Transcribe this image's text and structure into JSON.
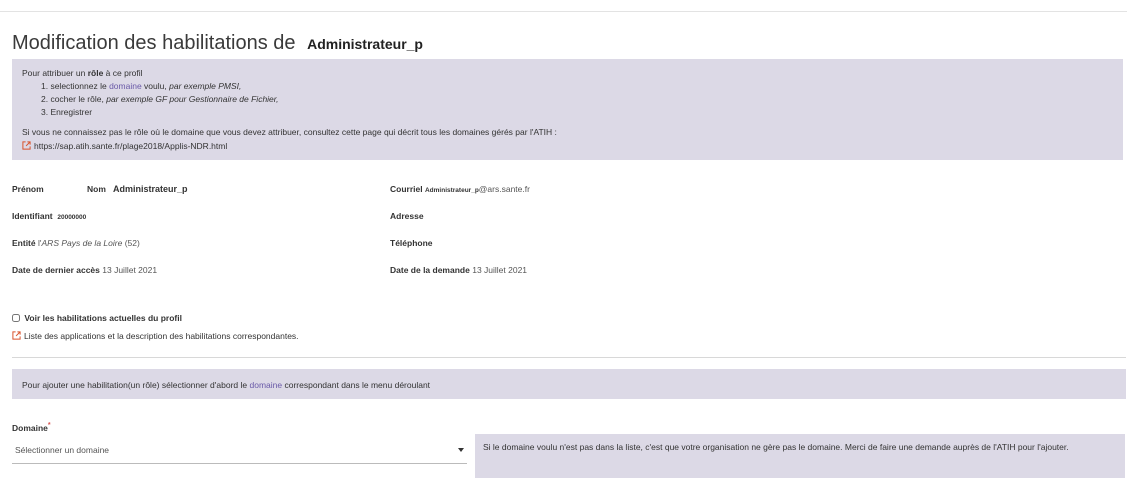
{
  "header": {
    "title": "Modification des habilitations de",
    "target_name": "Administrateur_p"
  },
  "help": {
    "intro_prefix": "Pour attribuer un",
    "intro_bold": "rôle",
    "intro_suffix": "à ce profil",
    "step1_prefix": "1. selectionnez le",
    "step1_domain": "domaine",
    "step1_mid": "voulu,",
    "step1_example": "par exemple PMSI,",
    "step2_prefix": "2. cocher le rôle,",
    "step2_example": "par exemple GF pour Gestionnaire de Fichier,",
    "step3": "3. Enregistrer",
    "note": "Si vous ne connaissez pas le rôle où le domaine que vous devez attribuer, consultez cette page qui décrit tous les domaines gérés par l'ATIH :",
    "link": "https://sap.atih.sante.fr/plage2018/Applis-NDR.html"
  },
  "profile": {
    "prenom_label": "Prénom",
    "nom_label": "Nom",
    "nom_value": "Administrateur_p",
    "courriel_label": "Courriel",
    "courriel_user": "Administrateur_p",
    "courriel_domain": "@ars.sante.fr",
    "identifiant_label": "Identifiant",
    "identifiant_value": "20000000",
    "adresse_label": "Adresse",
    "entite_label": "Entité",
    "entite_prefix": "l'",
    "entite_value": "ARS Pays de la Loire",
    "entite_code": "(52)",
    "telephone_label": "Téléphone",
    "dernier_acces_label": "Date de dernier accès",
    "dernier_acces_value": "13 Juillet 2021",
    "demande_label": "Date de la demande",
    "demande_value": "13 Juillet 2021"
  },
  "habilitations": {
    "checkbox_label": "Voir les habilitations actuelles du profil",
    "checked": false,
    "link": "Liste des applications et la description des habilitations correspondantes."
  },
  "add_info": {
    "prefix": "Pour ajouter une habilitation(un rôle) sélectionner d'abord le",
    "domain": "domaine",
    "suffix": "correspondant dans le menu déroulant"
  },
  "domain_field": {
    "label": "Domaine",
    "required_mark": "*",
    "placeholder": "Sélectionner un domaine",
    "note": "Si le domaine voulu n'est pas dans la liste, c'est que votre organisation ne gère pas le domaine. Merci de faire une demande auprès de l'ATIH pour l'ajouter."
  },
  "colors": {
    "panel": "#dcd9e6",
    "link": "#d9532c",
    "domain_text": "#6a5aa8",
    "required": "#d9534f"
  }
}
